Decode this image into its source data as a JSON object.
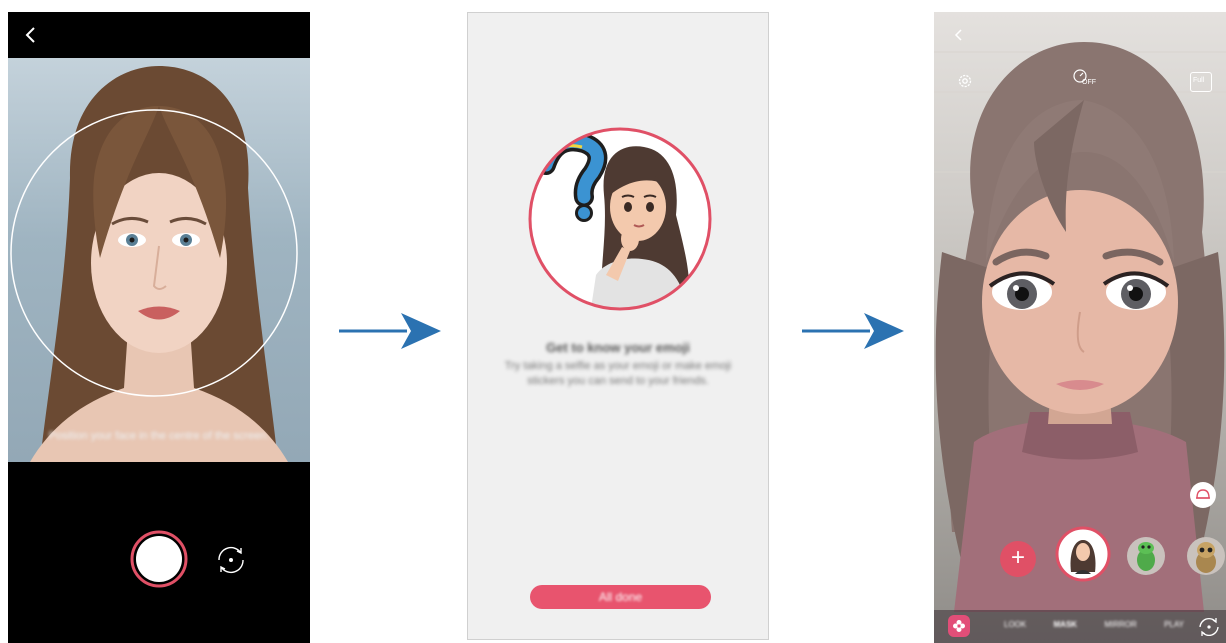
{
  "screen1": {
    "hint": "Position your face in the centre of the screen.",
    "icons": {
      "back": "back-arrow-icon",
      "switch_camera": "switch-camera-icon"
    }
  },
  "screen2": {
    "title": "Get to know your emoji",
    "description": "Try taking a selfie as your emoji or make emoji stickers you can send to your friends.",
    "done_button": "All done"
  },
  "screen3": {
    "timer_label": "OFF",
    "ratio_label": "Full",
    "add_label": "+",
    "modes": [
      "LOOK",
      "MASK",
      "MIRROR",
      "PLAY"
    ],
    "icons": {
      "back": "back-arrow-icon",
      "settings": "gear-icon",
      "timer": "timer-icon",
      "ratio": "aspect-ratio-icon",
      "sticker": "sticker-icon",
      "sticker_store": "flower-icon",
      "switch_camera": "switch-camera-icon"
    }
  },
  "colors": {
    "accent_red": "#e05066",
    "done_button": "#e8546e",
    "arrow_blue": "#2b72b1",
    "sticker_store": "#e24e78"
  }
}
